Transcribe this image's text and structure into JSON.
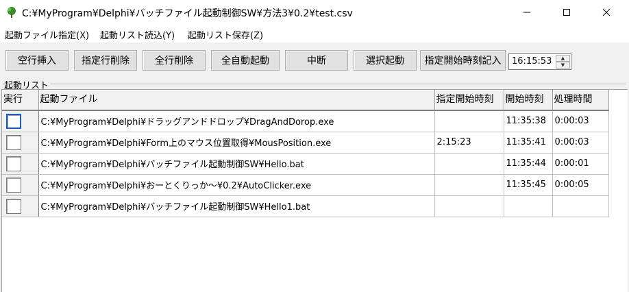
{
  "window": {
    "title": "C:¥MyProgram¥Delphi¥バッチファイル起動制御SW¥方法3¥0.2¥test.csv",
    "icon": "tree-app-icon"
  },
  "menu": [
    "起動ファイル指定(X)",
    "起動リスト読込(Y)",
    "起動リスト保存(Z)"
  ],
  "toolbar": {
    "buttons": [
      "空行挿入",
      "指定行削除",
      "全行削除",
      "全自動起動",
      "中断",
      "選択起動",
      "指定開始時刻記入"
    ],
    "time_value": "16:15:53"
  },
  "group": {
    "label": "起動リスト"
  },
  "grid": {
    "columns": [
      "実行",
      "起動ファイル",
      "指定開始時刻",
      "開始時刻",
      "処理時間"
    ],
    "rows": [
      {
        "checked": false,
        "file": "C:¥MyProgram¥Delphi¥ドラッグアンドドロップ¥DragAndDorop.exe",
        "specified": "",
        "start": "11:35:38",
        "duration": "0:00:03"
      },
      {
        "checked": false,
        "file": "C:¥MyProgram¥Delphi¥Form上のマウス位置取得¥MousPosition.exe",
        "specified": "2:15:23",
        "start": "11:35:41",
        "duration": "0:00:03"
      },
      {
        "checked": false,
        "file": "C:¥MyProgram¥Delphi¥バッチファイル起動制御SW¥Hello.bat",
        "specified": "",
        "start": "11:35:44",
        "duration": "0:00:01"
      },
      {
        "checked": false,
        "file": "C:¥MyProgram¥Delphi¥おーとくりっか～¥0.2¥AutoClicker.exe",
        "specified": "",
        "start": "11:35:45",
        "duration": "0:00:05"
      },
      {
        "checked": false,
        "file": "C:¥MyProgram¥Delphi¥バッチファイル起動制御SW¥Hello1.bat",
        "specified": "",
        "start": "",
        "duration": ""
      }
    ]
  }
}
